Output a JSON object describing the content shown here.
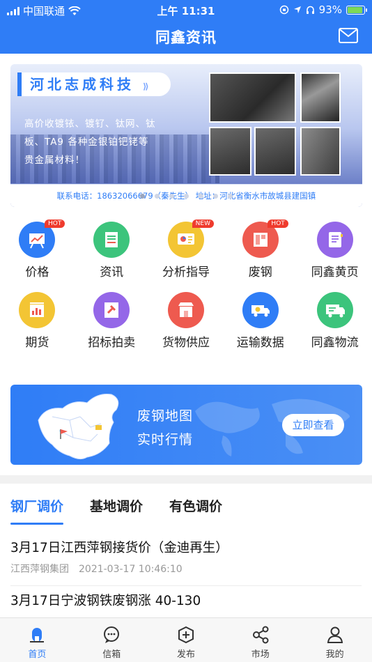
{
  "status_bar": {
    "carrier": "中国联通",
    "time": "上午 11:31",
    "battery": "93%",
    "battery_level": 0.93
  },
  "header": {
    "title": "同鑫资讯",
    "mail_icon": "mail-icon"
  },
  "banner": {
    "brand": "河北志成科技",
    "description": "高价收镀铱、镀钌、钛网、钛板、TA9 各种金银铂钯铑等贵金属材料！",
    "contact": "联系电话：18632066679（秦先生）   地址：河北省衡水市故城县建国镇",
    "slides": 7,
    "active_slide": 0
  },
  "categories": [
    {
      "label": "价格",
      "icon": "price-board-icon",
      "color": "#2f7df6",
      "badge": "HOT"
    },
    {
      "label": "资讯",
      "icon": "news-icon",
      "color": "#3cc47c",
      "badge": ""
    },
    {
      "label": "分析指导",
      "icon": "analysis-icon",
      "color": "#f3c534",
      "badge": "NEW"
    },
    {
      "label": "废钢",
      "icon": "scrap-steel-icon",
      "color": "#ee5a4f",
      "badge": "HOT"
    },
    {
      "label": "同鑫黄页",
      "icon": "yellow-pages-icon",
      "color": "#9467e8",
      "badge": ""
    },
    {
      "label": "期货",
      "icon": "futures-icon",
      "color": "#f3c534",
      "badge": ""
    },
    {
      "label": "招标拍卖",
      "icon": "auction-icon",
      "color": "#9467e8",
      "badge": ""
    },
    {
      "label": "货物供应",
      "icon": "shop-icon",
      "color": "#ee5a4f",
      "badge": ""
    },
    {
      "label": "运输数据",
      "icon": "transport-data-icon",
      "color": "#2f7df6",
      "badge": ""
    },
    {
      "label": "同鑫物流",
      "icon": "logistics-truck-icon",
      "color": "#3cc47c",
      "badge": ""
    }
  ],
  "map_card": {
    "line1": "废钢地图",
    "line2": "实时行情",
    "cta": "立即查看"
  },
  "tabs": [
    {
      "label": "钢厂调价",
      "active": true
    },
    {
      "label": "基地调价",
      "active": false
    },
    {
      "label": "有色调价",
      "active": false
    }
  ],
  "news": [
    {
      "title": "3月17日江西萍钢接货价（金迪再生）",
      "source": "江西萍钢集团",
      "time": "2021-03-17 10:46:10"
    },
    {
      "title": "3月17日宁波钢铁废钢涨 40-130",
      "source": "",
      "time": ""
    }
  ],
  "tabbar": [
    {
      "label": "首页",
      "icon": "home-icon",
      "active": true
    },
    {
      "label": "信箱",
      "icon": "message-icon",
      "active": false
    },
    {
      "label": "发布",
      "icon": "publish-icon",
      "active": false
    },
    {
      "label": "市场",
      "icon": "market-share-icon",
      "active": false
    },
    {
      "label": "我的",
      "icon": "profile-icon",
      "active": false
    }
  ]
}
